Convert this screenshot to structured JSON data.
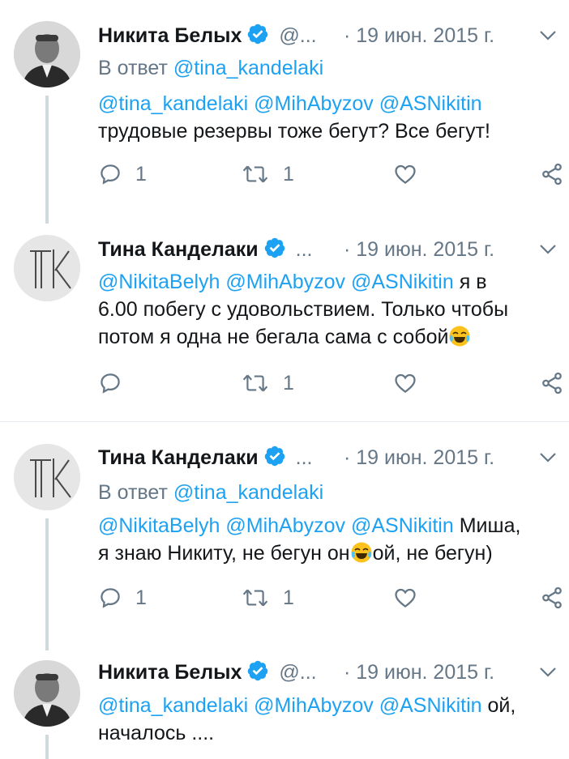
{
  "tweets": [
    {
      "name": "Никита Белых",
      "handle": "@...",
      "date": "· 19 июн. 2015 г.",
      "reply_label": "В ответ",
      "reply_handle": "@tina_kandelaki",
      "mentions": "@tina_kandelaki @MihAbyzov @ASNikitin",
      "text_line1": "",
      "text_rest": "трудовые резервы тоже бегут? Все бегут!",
      "reply_count": "1",
      "retweet_count": "1"
    },
    {
      "name": "Тина Канделаки",
      "handle": "...",
      "date": "· 19 июн. 2015 г.",
      "mentions": "@NikitaBelyh @MihAbyzov @ASNikitin",
      "text_line1": "я в",
      "text_line2": "6.00 побегу с удовольствием. Только чтобы",
      "text_line3": "потом я одна не бегала сама с собой",
      "reply_count": "",
      "retweet_count": "1"
    },
    {
      "name": "Тина Канделаки",
      "handle": "...",
      "date": "· 19 июн. 2015 г.",
      "reply_label": "В ответ",
      "reply_handle": "@tina_kandelaki",
      "mentions": "@NikitaBelyh @MihAbyzov @ASNikitin",
      "text_line1": "Миша,",
      "text_line2a": "я знаю Никиту, не бегун он",
      "text_line2b": "ой, не бегун)",
      "reply_count": "1",
      "retweet_count": "1"
    },
    {
      "name": "Никита Белых",
      "handle": "@...",
      "date": "· 19 июн. 2015 г.",
      "mentions": "@tina_kandelaki @MihAbyzov @ASNikitin",
      "text_line1": "ой,",
      "text_line2": "началось ...."
    }
  ],
  "colors": {
    "link": "#1da1f2",
    "muted": "#657786",
    "verified": "#1da1f2",
    "line": "#cfd9de"
  },
  "avatars": {
    "nikita": "TK",
    "tina": "TK"
  },
  "icons": [
    "reply-icon",
    "retweet-icon",
    "like-icon",
    "share-icon",
    "chevron-down-icon",
    "verified-icon",
    "tears-of-joy-emoji"
  ]
}
